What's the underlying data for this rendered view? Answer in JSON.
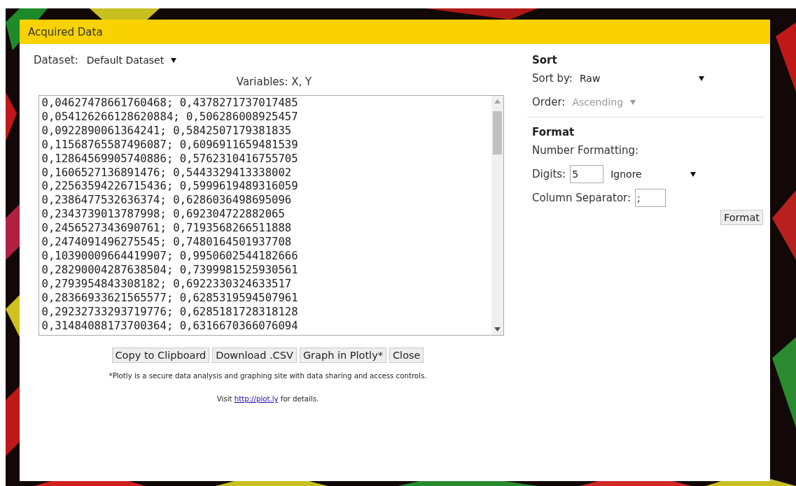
{
  "window": {
    "title": "Acquired Data"
  },
  "dataset": {
    "label": "Dataset:",
    "value": "Default Dataset"
  },
  "variables": "Variables: X, Y",
  "data_lines": [
    "0,04627478661760468; 0,4378271737017485",
    "0,054126266128620884; 0,506286008925457",
    "0,0922890061364241; 0,5842507179381835",
    "0,11568765587496087; 0,6096911659481539",
    "0,12864569905740886; 0,5762310416755705",
    "0,1606527136891476; 0,5443329413338002",
    "0,22563594226715436; 0,5999619489316059",
    "0,2386477532636374; 0,6286036498695096",
    "0,2343739013787998; 0,692304722882065",
    "0,2456527343690761; 0,7193568266511888",
    "0,2474091496275545; 0,7480164501937708",
    "0,10390009664419907; 0,9950602544182666",
    "0,28290004287638504; 0,7399981525930561",
    "0,2793954843308182; 0,6922330324633517",
    "0,28366933621565577; 0,6285319594507961",
    "0,29232733293719776; 0,6285181728318128",
    "0,31484088173700364; 0,6316670366076094"
  ],
  "buttons": [
    "Copy to Clipboard",
    "Download .CSV",
    "Graph in Plotly*",
    "Close"
  ],
  "footnote": "*Plotly is a secure data analysis and graphing site with data sharing and access controls.",
  "visit": {
    "before": "Visit",
    "link": "http://plot.ly",
    "after": "for details."
  },
  "sort": {
    "heading": "Sort",
    "sort_by": {
      "label": "Sort by:",
      "value": "Raw",
      "disabled": false
    },
    "order": {
      "label": "Order:",
      "value": "Ascending",
      "disabled": true
    }
  },
  "format": {
    "heading": "Format",
    "number_formatting": "Number Formatting:",
    "digits": {
      "label": "Digits:",
      "value": "5"
    },
    "rounding": {
      "value": "Ignore",
      "disabled": false
    },
    "column_separator": {
      "label": "Column Separator:",
      "value": ";"
    },
    "button": "Format"
  }
}
